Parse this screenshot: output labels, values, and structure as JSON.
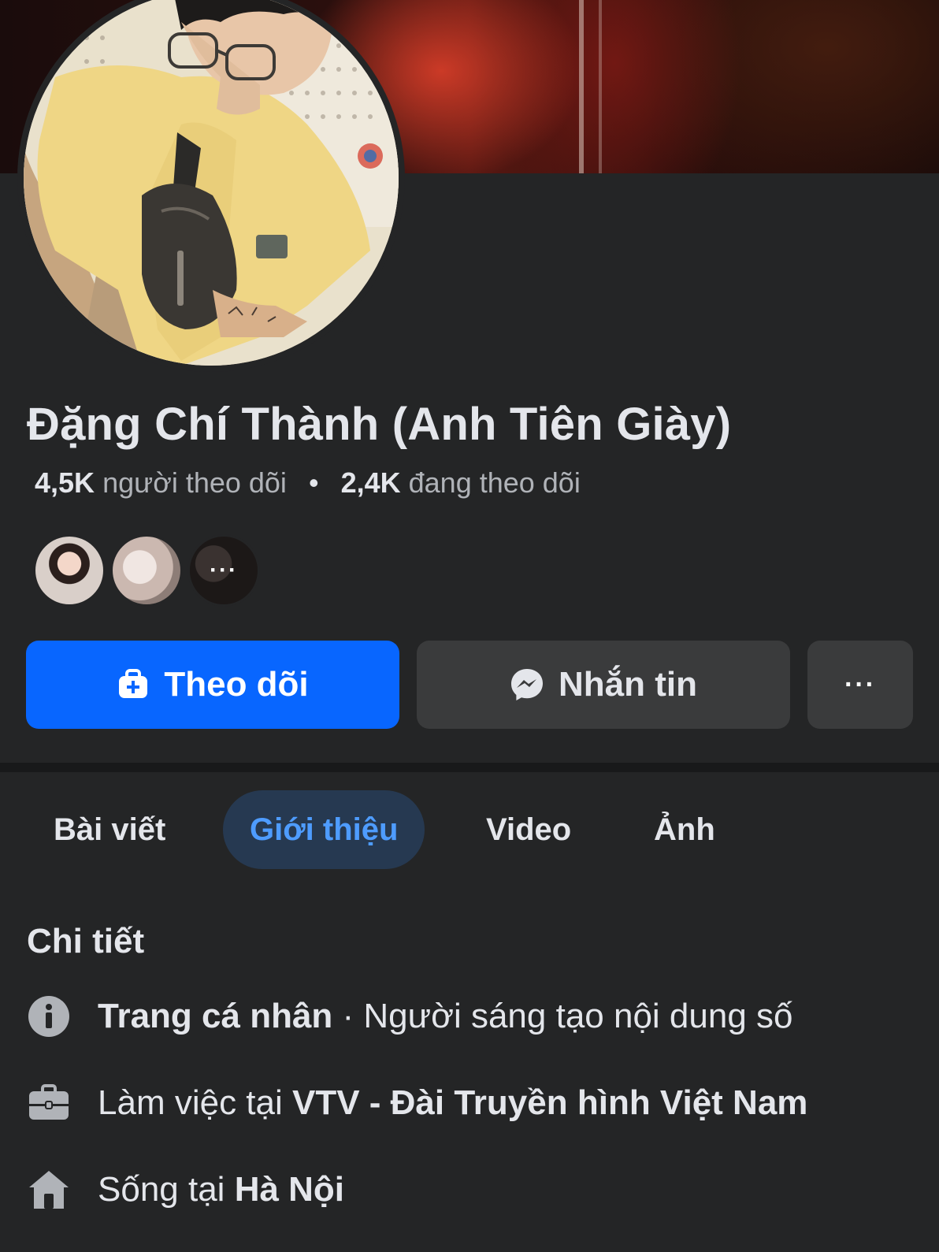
{
  "profile": {
    "name": "Đặng Chí Thành (Anh Tiên Giày)",
    "followers_count": "4,5K",
    "followers_label": "người theo dõi",
    "following_count": "2,4K",
    "following_label": "đang theo dõi",
    "separator": "•"
  },
  "friends": {
    "more_label": "···"
  },
  "actions": {
    "follow_label": "Theo dõi",
    "message_label": "Nhắn tin",
    "more_label": "···"
  },
  "tabs": [
    {
      "label": "Bài viết",
      "active": false
    },
    {
      "label": "Giới thiệu",
      "active": true
    },
    {
      "label": "Video",
      "active": false
    },
    {
      "label": "Ảnh",
      "active": false
    }
  ],
  "details": {
    "title": "Chi tiết",
    "items": [
      {
        "icon": "info-icon",
        "bold": "Trang cá nhân",
        "rest": " · Người sáng tạo nội dung số"
      },
      {
        "icon": "briefcase-icon",
        "prefix": "Làm việc tại ",
        "bold": "VTV - Đài Truyền hình Việt Nam"
      },
      {
        "icon": "home-icon",
        "prefix": "Sống tại ",
        "bold": "Hà Nội"
      }
    ]
  },
  "colors": {
    "background": "#242526",
    "accent": "#0866ff",
    "active_tab_bg": "#263951",
    "active_tab_text": "#4e9cff",
    "secondary_button": "#3a3b3c"
  }
}
